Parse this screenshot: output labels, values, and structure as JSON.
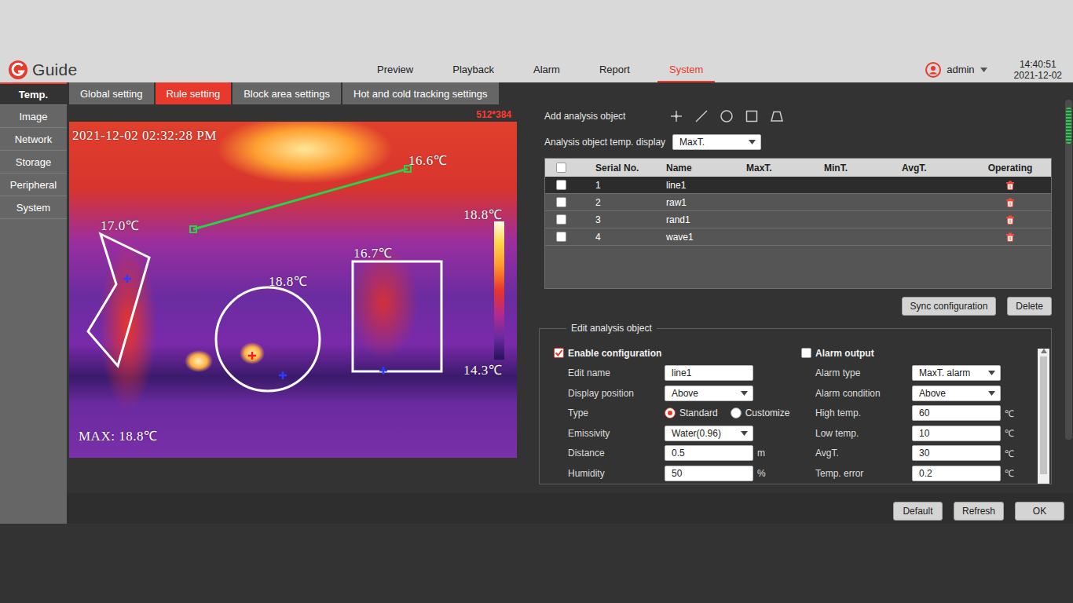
{
  "brand": {
    "name": "Guide"
  },
  "nav": [
    {
      "label": "Preview",
      "selected": false
    },
    {
      "label": "Playback",
      "selected": false
    },
    {
      "label": "Alarm",
      "selected": false
    },
    {
      "label": "Report",
      "selected": false
    },
    {
      "label": "System",
      "selected": true
    }
  ],
  "user": {
    "name": "admin"
  },
  "clock": {
    "time": "14:40:51",
    "date": "2021-12-02"
  },
  "sidebar": [
    {
      "label": "Temp.",
      "selected": true
    },
    {
      "label": "Image",
      "selected": false
    },
    {
      "label": "Network",
      "selected": false
    },
    {
      "label": "Storage",
      "selected": false
    },
    {
      "label": "Peripheral",
      "selected": false
    },
    {
      "label": "System",
      "selected": false
    }
  ],
  "subtabs": [
    {
      "label": "Global setting",
      "selected": false
    },
    {
      "label": "Rule setting",
      "selected": true
    },
    {
      "label": "Block area settings",
      "selected": false
    },
    {
      "label": "Hot and cold tracking settings",
      "selected": false
    }
  ],
  "video": {
    "resolution": "512*384",
    "timestamp": "2021-12-02 02:32:28 PM",
    "max_label": "MAX: 18.8℃",
    "scale": {
      "high": "18.8℃",
      "low": "14.3℃"
    },
    "overlays": [
      {
        "kind": "line",
        "label": "16.6℃"
      },
      {
        "kind": "polygon",
        "label": "17.0℃"
      },
      {
        "kind": "circle",
        "label": "18.8℃"
      },
      {
        "kind": "rect",
        "label": "16.7℃"
      }
    ]
  },
  "tools": {
    "label": "Add analysis object"
  },
  "temp_display": {
    "label": "Analysis object temp. display",
    "value": "MaxT."
  },
  "table": {
    "all_checked": false,
    "columns": [
      "Serial No.",
      "Name",
      "MaxT.",
      "MinT.",
      "AvgT.",
      "Operating"
    ],
    "rows": [
      {
        "serial": "1",
        "name": "line1",
        "max": "",
        "min": "",
        "avg": "",
        "checked": false,
        "selected": true
      },
      {
        "serial": "2",
        "name": "raw1",
        "max": "",
        "min": "",
        "avg": "",
        "checked": false,
        "selected": false
      },
      {
        "serial": "3",
        "name": "rand1",
        "max": "",
        "min": "",
        "avg": "",
        "checked": false,
        "selected": false
      },
      {
        "serial": "4",
        "name": "wave1",
        "max": "",
        "min": "",
        "avg": "",
        "checked": false,
        "selected": false
      }
    ]
  },
  "table_actions": [
    "Sync configuration",
    "Delete"
  ],
  "editor": {
    "title": "Edit analysis object",
    "left": [
      {
        "kind": "checkbox",
        "label": "Enable configuration",
        "checked": true
      },
      {
        "kind": "text",
        "label": "Edit name",
        "value": "line1"
      },
      {
        "kind": "select",
        "label": "Display position",
        "value": "Above"
      },
      {
        "kind": "radio",
        "label": "Type",
        "options": [
          {
            "label": "Standard",
            "selected": true
          },
          {
            "label": "Customize",
            "selected": false
          }
        ]
      },
      {
        "kind": "select",
        "label": "Emissivity",
        "value": "Water(0.96)"
      },
      {
        "kind": "text",
        "label": "Distance",
        "value": "0.5",
        "unit": "m"
      },
      {
        "kind": "text",
        "label": "Humidity",
        "value": "50",
        "unit": "%"
      }
    ],
    "right": [
      {
        "kind": "checkbox",
        "label": "Alarm output",
        "checked": false
      },
      {
        "kind": "select",
        "label": "Alarm type",
        "value": "MaxT. alarm"
      },
      {
        "kind": "select",
        "label": "Alarm condition",
        "value": "Above"
      },
      {
        "kind": "text",
        "label": "High temp.",
        "value": "60",
        "unit": "℃"
      },
      {
        "kind": "text",
        "label": "Low temp.",
        "value": "10",
        "unit": "℃"
      },
      {
        "kind": "text",
        "label": "AvgT.",
        "value": "30",
        "unit": "℃"
      },
      {
        "kind": "text",
        "label": "Temp. error",
        "value": "0.2",
        "unit": "℃"
      }
    ]
  },
  "footer_buttons": [
    "Default",
    "Refresh",
    "OK"
  ]
}
